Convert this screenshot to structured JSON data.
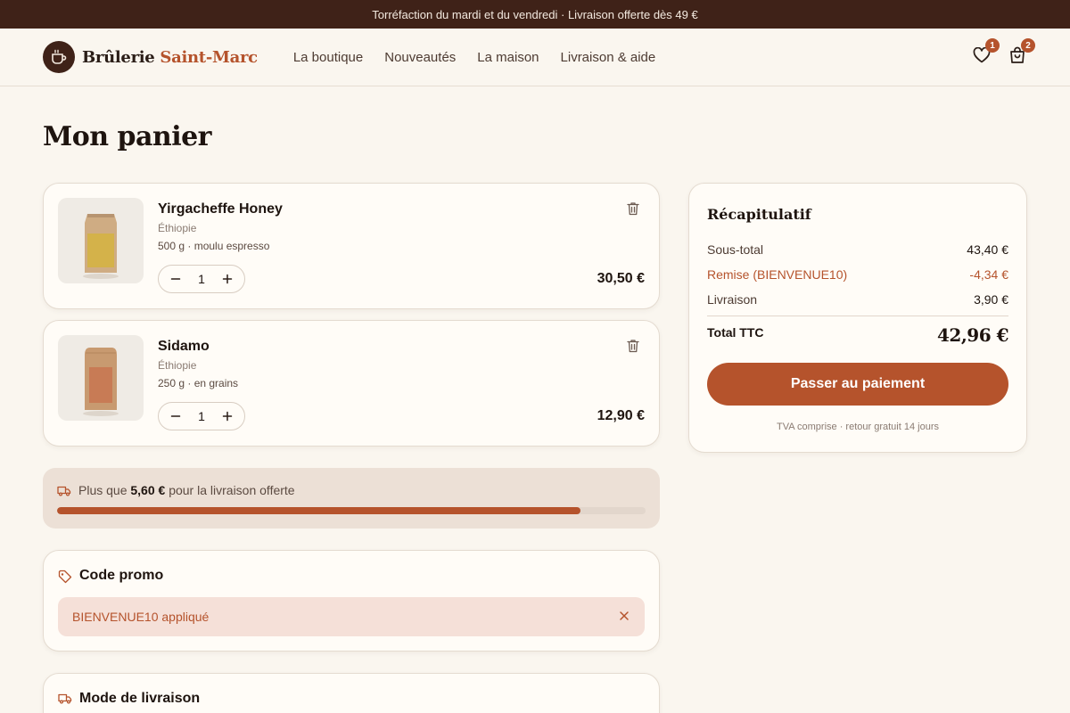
{
  "topbar": {
    "text": "Torréfaction du mardi et du vendredi · Livraison offerte dès 49 €"
  },
  "header": {
    "brand_main": "Brûlerie",
    "brand_accent": "Saint-Marc",
    "nav": [
      "La boutique",
      "Nouveautés",
      "La maison",
      "Livraison & aide"
    ],
    "wishlist_count": "1",
    "cart_count": "2"
  },
  "page": {
    "title": "Mon panier"
  },
  "cart": {
    "items": [
      {
        "name": "Yirgacheffe Honey",
        "origin": "Éthiopie",
        "details": "500 g · moulu espresso",
        "quantity": "1",
        "price": "30,50 €",
        "bag_color": "#d4b24a"
      },
      {
        "name": "Sidamo",
        "origin": "Éthiopie",
        "details": "250 g · en grains",
        "quantity": "1",
        "price": "12,90 €",
        "bag_color": "#c87b55"
      }
    ]
  },
  "shipping": {
    "prefix": "Plus que",
    "amount": "5,60 €",
    "suffix": "pour la livraison offerte",
    "progress": 0.89
  },
  "promo": {
    "title": "Code promo",
    "applied_text": "BIENVENUE10 appliqué"
  },
  "delivery": {
    "title": "Mode de livraison"
  },
  "summary": {
    "title": "Récapitulatif",
    "subtotal_label": "Sous-total",
    "subtotal_value": "43,40 €",
    "discount_label": "Remise (BIENVENUE10)",
    "discount_value": "-4,34 €",
    "shipping_label": "Livraison",
    "shipping_value": "3,90 €",
    "total_label": "Total TTC",
    "total_value": "42,96 €",
    "checkout_label": "Passer au paiement",
    "note": "TVA comprise · retour gratuit 14 jours"
  },
  "colors": {
    "accent": "#b5532c",
    "dark": "#3f2218",
    "background": "#faf6ef"
  }
}
